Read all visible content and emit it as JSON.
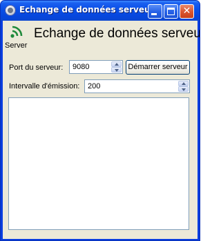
{
  "window": {
    "title": "Echange de données serveur",
    "controls": {
      "minimize": "minimize",
      "maximize": "maximize",
      "close": "✕"
    }
  },
  "header": {
    "icon": "wifi-signal-icon",
    "icon_caption": "Server",
    "heading": "Echange de données serveur"
  },
  "form": {
    "port_label": "Port du serveur:",
    "port_value": "9080",
    "start_button": "Démarrer serveur",
    "interval_label": "Intervalle d'émission:",
    "interval_value": "200"
  },
  "log": {
    "content": ""
  },
  "colors": {
    "titlebar": "#0a4fe6",
    "client_bg": "#ece9d8",
    "signal_green": "#1f8a3b"
  }
}
